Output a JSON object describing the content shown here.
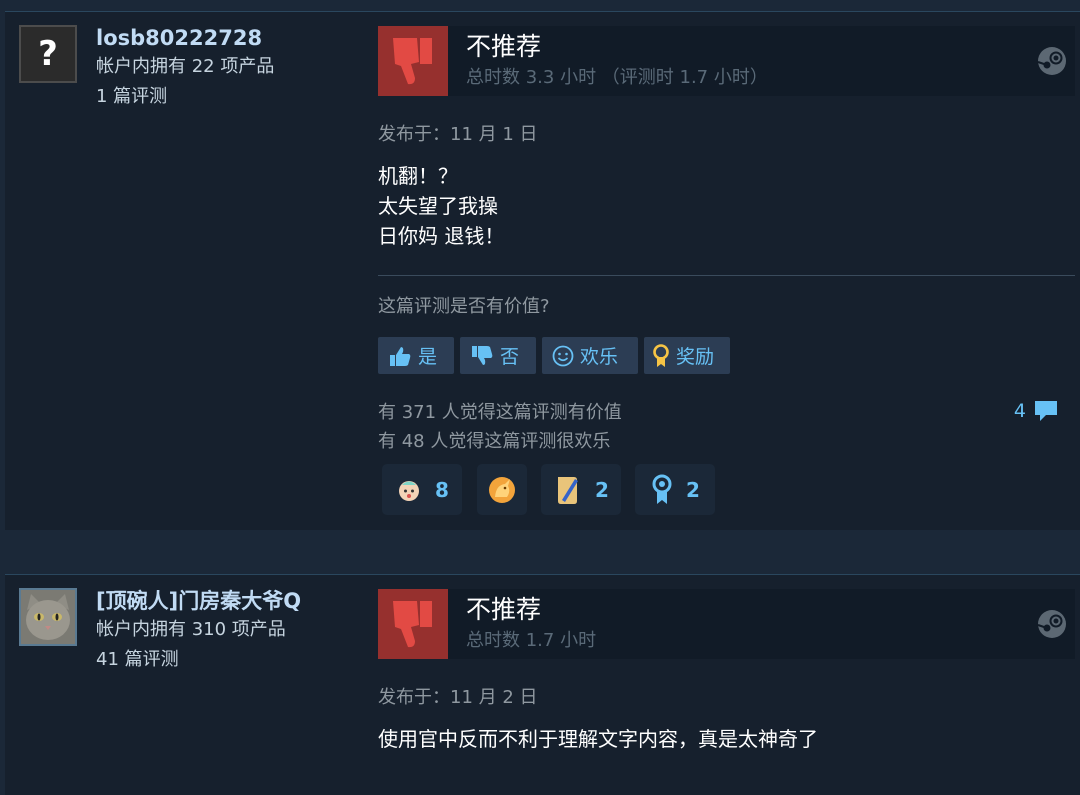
{
  "reviews": [
    {
      "author": {
        "name": "losb80222728",
        "products": "帐户内拥有 22 项产品",
        "review_count": "1 篇评测",
        "avatar": "question-mark"
      },
      "verdict": "不推荐",
      "hours": "总时数 3.3 小时 （评测时 1.7 小时）",
      "posted": "发布于：11 月 1 日",
      "content": [
        "机翻！？",
        "太失望了我操",
        "日你妈 退钱！"
      ],
      "helpful_question": "这篇评测是否有价值?",
      "buttons": {
        "yes": "是",
        "no": "否",
        "funny": "欢乐",
        "award": "奖励"
      },
      "stats": [
        "有 371 人觉得这篇评测有价值",
        "有 48 人觉得这篇评测很欢乐"
      ],
      "comment_count": "4",
      "awards": [
        {
          "icon": "baby-face-icon",
          "count": "8"
        },
        {
          "icon": "golden-unicorn-icon",
          "count": ""
        },
        {
          "icon": "scroll-quill-icon",
          "count": "2"
        },
        {
          "icon": "ribbon-award-icon",
          "count": "2"
        }
      ]
    },
    {
      "author": {
        "name": "[顶碗人]门房秦大爷Q",
        "products": "帐户内拥有 310 项产品",
        "review_count": "41 篇评测",
        "avatar": "cat"
      },
      "verdict": "不推荐",
      "hours": "总时数 1.7 小时",
      "posted": "发布于：11 月 2 日",
      "content": [
        "使用官中反而不利于理解文字内容，真是太神奇了"
      ]
    }
  ],
  "colors": {
    "thumb_down_bg": "#96302e",
    "link_blue": "#67c1f5",
    "page_bg": "#1b2838"
  }
}
